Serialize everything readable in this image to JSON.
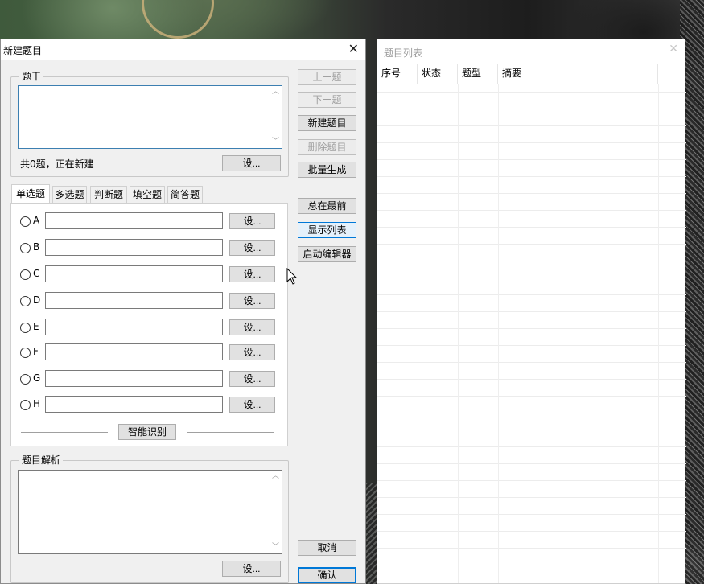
{
  "dialog": {
    "title": "新建题目",
    "close_glyph": "✕",
    "stem_group": {
      "label": "题干",
      "value": ""
    },
    "count_status": "共0题，正在新建",
    "set_button": "设...",
    "tabs": [
      {
        "label": "单选题",
        "active": true
      },
      {
        "label": "多选题",
        "active": false
      },
      {
        "label": "判断题",
        "active": false
      },
      {
        "label": "填空题",
        "active": false
      },
      {
        "label": "简答题",
        "active": false
      }
    ],
    "options": [
      {
        "letter": "A",
        "value": "",
        "set_label": "设..."
      },
      {
        "letter": "B",
        "value": "",
        "set_label": "设..."
      },
      {
        "letter": "C",
        "value": "",
        "set_label": "设..."
      },
      {
        "letter": "D",
        "value": "",
        "set_label": "设..."
      },
      {
        "letter": "E",
        "value": "",
        "set_label": "设..."
      },
      {
        "letter": "F",
        "value": "",
        "set_label": "设..."
      },
      {
        "letter": "G",
        "value": "",
        "set_label": "设..."
      },
      {
        "letter": "H",
        "value": "",
        "set_label": "设..."
      }
    ],
    "smart_recognize": "智能识别",
    "analysis_group": {
      "label": "题目解析",
      "value": "",
      "set_label": "设..."
    },
    "side_buttons": {
      "prev": "上一题",
      "next": "下一题",
      "new_question": "新建题目",
      "delete_question": "删除题目",
      "batch_generate": "批量生成",
      "always_on_top": "总在最前",
      "show_list": "显示列表",
      "launch_editor": "启动编辑器",
      "cancel": "取消",
      "confirm": "确认"
    }
  },
  "list_window": {
    "title": "题目列表",
    "close_glyph": "✕",
    "columns": [
      "序号",
      "状态",
      "题型",
      "摘要"
    ]
  },
  "colors": {
    "accent": "#0078d7",
    "dialog_bg": "#f0f0f0"
  }
}
